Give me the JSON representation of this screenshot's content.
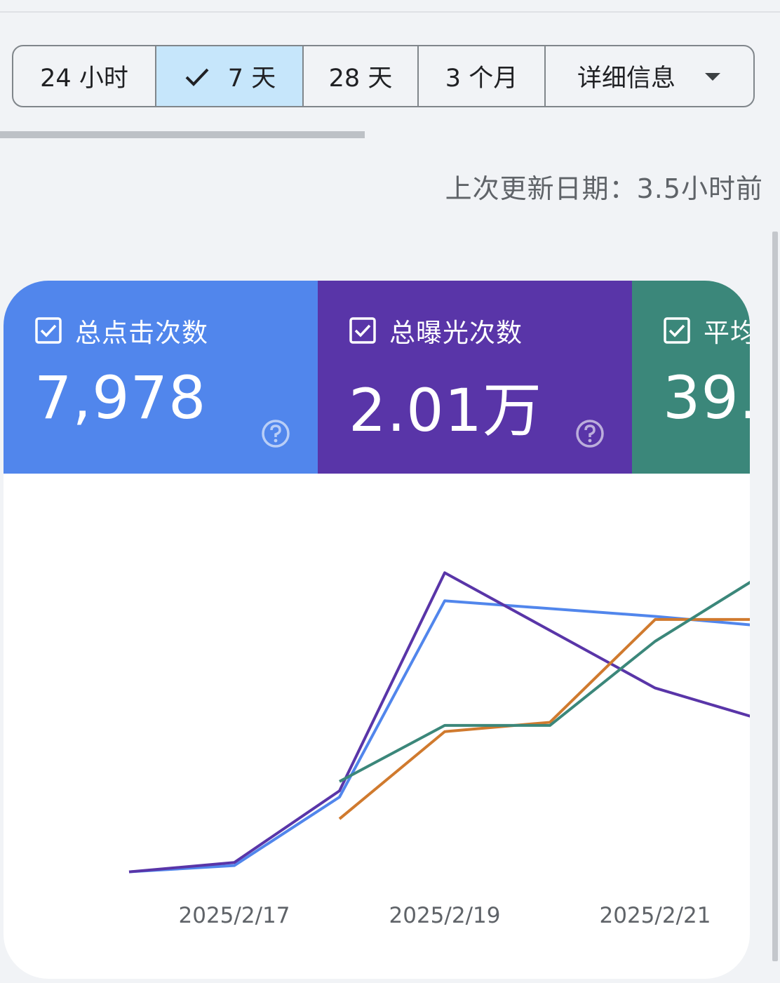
{
  "range_selector": {
    "options": [
      {
        "label": "24 小时",
        "selected": false
      },
      {
        "label": "7 天",
        "selected": true
      },
      {
        "label": "28 天",
        "selected": false
      },
      {
        "label": "3 个月",
        "selected": false
      },
      {
        "label": "详细信息",
        "selected": false
      }
    ]
  },
  "last_updated": "上次更新日期：3.5小时前",
  "metrics": {
    "clicks": {
      "label": "总点击次数",
      "value": "7,978",
      "checked": true,
      "color": "#5186ec"
    },
    "impressions": {
      "label": "总曝光次数",
      "value": "2.01万",
      "checked": true,
      "color": "#5935a8"
    },
    "ctr": {
      "label": "平均",
      "value": "39.",
      "checked": true,
      "color": "#3b877a"
    }
  },
  "icons": {
    "check": "check-icon",
    "dropdown": "dropdown-arrow-icon",
    "checkbox": "checkbox-checked-icon",
    "help": "help-circle-icon"
  },
  "chart_data": {
    "type": "line",
    "x": [
      "2025/2/16",
      "2025/2/17",
      "2025/2/18",
      "2025/2/19",
      "2025/2/20",
      "2025/2/21",
      "2025/2/22"
    ],
    "x_tick_labels": [
      "2025/2/17",
      "2025/2/19",
      "2025/2/21"
    ],
    "series": [
      {
        "color": "#5186ec",
        "values": [
          1,
          3,
          25,
          88,
          null,
          83,
          80
        ]
      },
      {
        "color": "#5935a8",
        "values": [
          1,
          4,
          27,
          97,
          null,
          60,
          50
        ]
      },
      {
        "color": "#d07a2e",
        "values": [
          null,
          null,
          18,
          46,
          49,
          82,
          82
        ]
      },
      {
        "color": "#3b877a",
        "values": [
          null,
          null,
          30,
          48,
          48,
          75,
          96
        ]
      }
    ],
    "grid": false,
    "legend": "none"
  }
}
